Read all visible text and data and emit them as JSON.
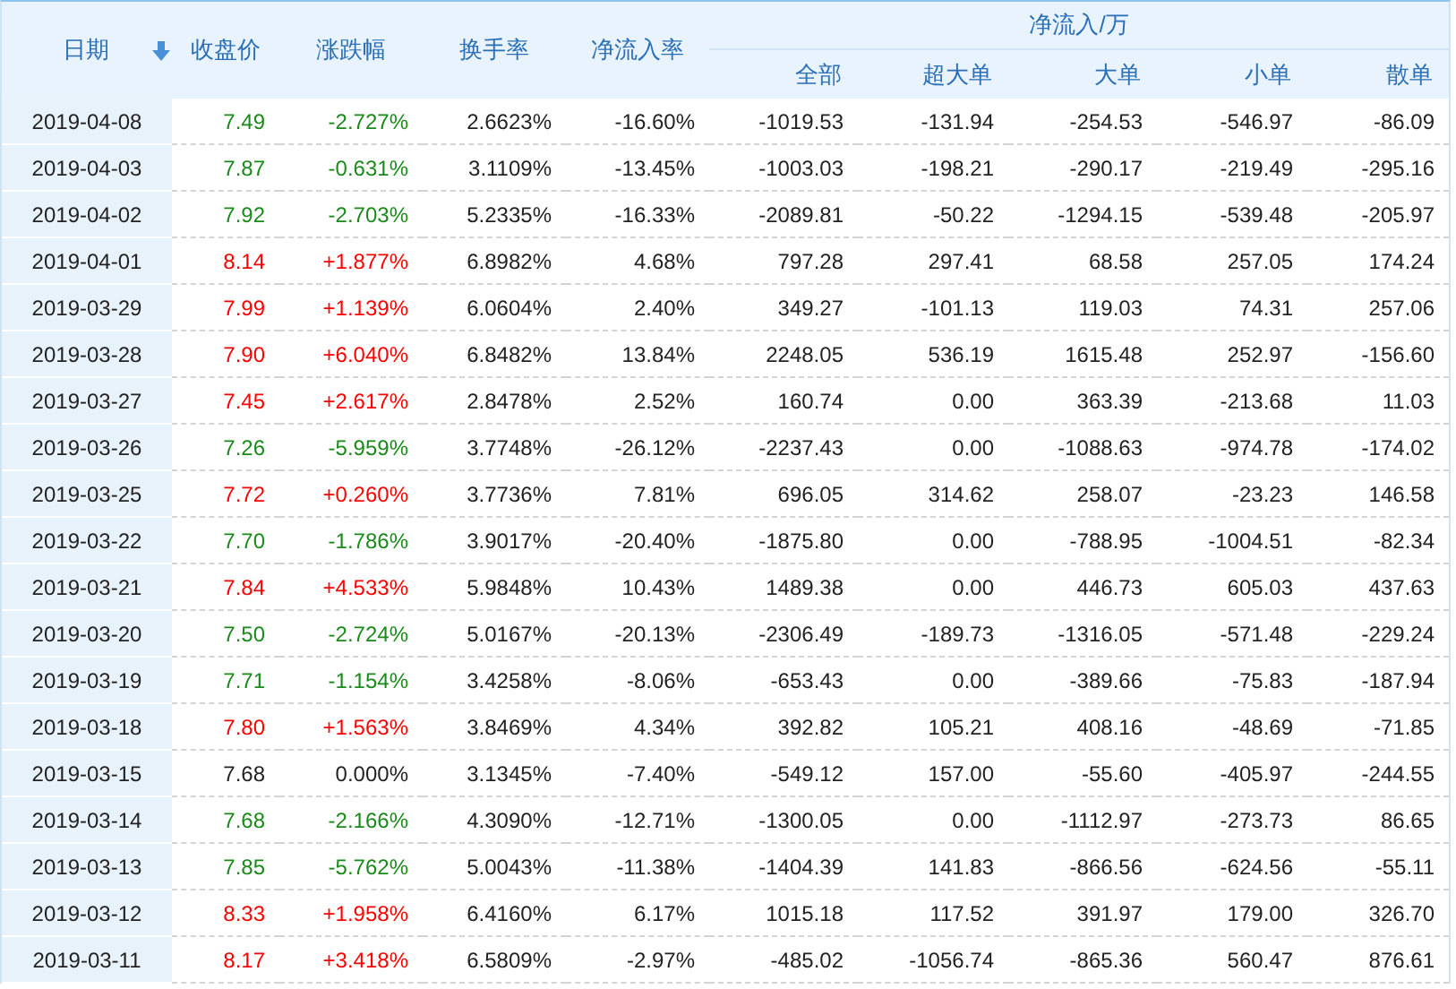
{
  "table": {
    "columns": [
      {
        "label": "日期",
        "sorted": true
      },
      {
        "label": "收盘价"
      },
      {
        "label": "涨跌幅"
      },
      {
        "label": "换手率"
      },
      {
        "label": "净流入率"
      }
    ],
    "group": {
      "label": "净流入/万",
      "columns": [
        "全部",
        "超大单",
        "大单",
        "小单",
        "散单"
      ]
    },
    "rows": [
      {
        "color": "#1a8a1a",
        "cells": [
          "2019-04-08",
          "7.49",
          "-2.727%",
          "2.6623%",
          "-16.60%",
          "-1019.53",
          "-131.94",
          "-254.53",
          "-546.97",
          "-86.09"
        ]
      },
      {
        "color": "#1a8a1a",
        "cells": [
          "2019-04-03",
          "7.87",
          "-0.631%",
          "3.1109%",
          "-13.45%",
          "-1003.03",
          "-198.21",
          "-290.17",
          "-219.49",
          "-295.16"
        ]
      },
      {
        "color": "#1a8a1a",
        "cells": [
          "2019-04-02",
          "7.92",
          "-2.703%",
          "5.2335%",
          "-16.33%",
          "-2089.81",
          "-50.22",
          "-1294.15",
          "-539.48",
          "-205.97"
        ]
      },
      {
        "color": "#ff0000",
        "cells": [
          "2019-04-01",
          "8.14",
          "+1.877%",
          "6.8982%",
          "4.68%",
          "797.28",
          "297.41",
          "68.58",
          "257.05",
          "174.24"
        ]
      },
      {
        "color": "#ff0000",
        "cells": [
          "2019-03-29",
          "7.99",
          "+1.139%",
          "6.0604%",
          "2.40%",
          "349.27",
          "-101.13",
          "119.03",
          "74.31",
          "257.06"
        ]
      },
      {
        "color": "#ff0000",
        "cells": [
          "2019-03-28",
          "7.90",
          "+6.040%",
          "6.8482%",
          "13.84%",
          "2248.05",
          "536.19",
          "1615.48",
          "252.97",
          "-156.60"
        ]
      },
      {
        "color": "#ff0000",
        "cells": [
          "2019-03-27",
          "7.45",
          "+2.617%",
          "2.8478%",
          "2.52%",
          "160.74",
          "0.00",
          "363.39",
          "-213.68",
          "11.03"
        ]
      },
      {
        "color": "#1a8a1a",
        "cells": [
          "2019-03-26",
          "7.26",
          "-5.959%",
          "3.7748%",
          "-26.12%",
          "-2237.43",
          "0.00",
          "-1088.63",
          "-974.78",
          "-174.02"
        ]
      },
      {
        "color": "#ff0000",
        "cells": [
          "2019-03-25",
          "7.72",
          "+0.260%",
          "3.7736%",
          "7.81%",
          "696.05",
          "314.62",
          "258.07",
          "-23.23",
          "146.58"
        ]
      },
      {
        "color": "#1a8a1a",
        "cells": [
          "2019-03-22",
          "7.70",
          "-1.786%",
          "3.9017%",
          "-20.40%",
          "-1875.80",
          "0.00",
          "-788.95",
          "-1004.51",
          "-82.34"
        ]
      },
      {
        "color": "#ff0000",
        "cells": [
          "2019-03-21",
          "7.84",
          "+4.533%",
          "5.9848%",
          "10.43%",
          "1489.38",
          "0.00",
          "446.73",
          "605.03",
          "437.63"
        ]
      },
      {
        "color": "#1a8a1a",
        "cells": [
          "2019-03-20",
          "7.50",
          "-2.724%",
          "5.0167%",
          "-20.13%",
          "-2306.49",
          "-189.73",
          "-1316.05",
          "-571.48",
          "-229.24"
        ]
      },
      {
        "color": "#1a8a1a",
        "cells": [
          "2019-03-19",
          "7.71",
          "-1.154%",
          "3.4258%",
          "-8.06%",
          "-653.43",
          "0.00",
          "-389.66",
          "-75.83",
          "-187.94"
        ]
      },
      {
        "color": "#ff0000",
        "cells": [
          "2019-03-18",
          "7.80",
          "+1.563%",
          "3.8469%",
          "4.34%",
          "392.82",
          "105.21",
          "408.16",
          "-48.69",
          "-71.85"
        ]
      },
      {
        "color": "#222222",
        "cells": [
          "2019-03-15",
          "7.68",
          "0.000%",
          "3.1345%",
          "-7.40%",
          "-549.12",
          "157.00",
          "-55.60",
          "-405.97",
          "-244.55"
        ]
      },
      {
        "color": "#1a8a1a",
        "cells": [
          "2019-03-14",
          "7.68",
          "-2.166%",
          "4.3090%",
          "-12.71%",
          "-1300.05",
          "0.00",
          "-1112.97",
          "-273.73",
          "86.65"
        ]
      },
      {
        "color": "#1a8a1a",
        "cells": [
          "2019-03-13",
          "7.85",
          "-5.762%",
          "5.0043%",
          "-11.38%",
          "-1404.39",
          "141.83",
          "-866.56",
          "-624.56",
          "-55.11"
        ]
      },
      {
        "color": "#ff0000",
        "cells": [
          "2019-03-12",
          "8.33",
          "+1.958%",
          "6.4160%",
          "6.17%",
          "1015.18",
          "117.52",
          "391.97",
          "179.00",
          "326.70"
        ]
      },
      {
        "color": "#ff0000",
        "cells": [
          "2019-03-11",
          "8.17",
          "+3.418%",
          "6.5809%",
          "-2.97%",
          "-485.02",
          "-1056.74",
          "-865.36",
          "560.47",
          "876.61"
        ]
      }
    ]
  }
}
